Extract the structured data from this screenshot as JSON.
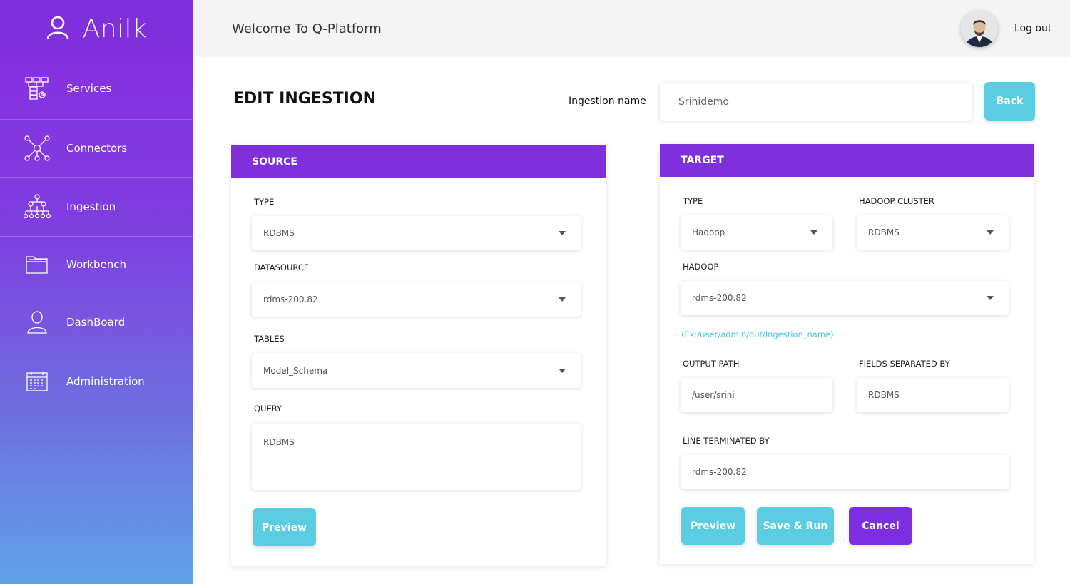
{
  "brand": {
    "name": "Anilk",
    "icon": "user-icon"
  },
  "sidebar": {
    "items": [
      {
        "label": "Services",
        "icon": "services-icon"
      },
      {
        "label": "Connectors",
        "icon": "network-icon"
      },
      {
        "label": "Ingestion",
        "icon": "hierarchy-icon"
      },
      {
        "label": "Workbench",
        "icon": "folder-icon"
      },
      {
        "label": "DashBoard",
        "icon": "person-icon"
      },
      {
        "label": "Administration",
        "icon": "calendar-icon"
      }
    ]
  },
  "header": {
    "welcome": "Welcome To Q-Platform",
    "logout": "Log out"
  },
  "page": {
    "title": "EDIT INGESTION",
    "ingestion_name_label": "Ingestion name",
    "ingestion_name_value": "Srinidemo",
    "back_label": "Back"
  },
  "source": {
    "title": "SOURCE",
    "type_label": "TYPE",
    "type_value": "RDBMS",
    "datasource_label": "DATASOURCE",
    "datasource_value": "rdms-200.82",
    "tables_label": "TABLES",
    "tables_value": "Model_Schema",
    "query_label": "QUERY",
    "query_value": "RDBMS",
    "preview_label": "Preview"
  },
  "target": {
    "title": "TARGET",
    "type_label": "TYPE",
    "type_value": "Hadoop",
    "cluster_label": "HADOOP CLUSTER",
    "cluster_value": "RDBMS",
    "hadoop_label": "HADOOP",
    "hadoop_value": "rdms-200.82",
    "hint": "(Ex:/user/admin/out/ingestion_name)",
    "output_label": "OUTPUT PATH",
    "output_value": "/user/srini",
    "fields_label": "FIELDS SEPARATED BY",
    "fields_value": "RDBMS",
    "line_label": "LINE TERMINATED BY",
    "line_value": "rdms-200.82",
    "preview_label": "Preview",
    "save_run_label": "Save & Run",
    "cancel_label": "Cancel"
  },
  "colors": {
    "accent": "#7f2fdc",
    "cyan": "#5bcde3",
    "hint": "#4ec3dd"
  }
}
